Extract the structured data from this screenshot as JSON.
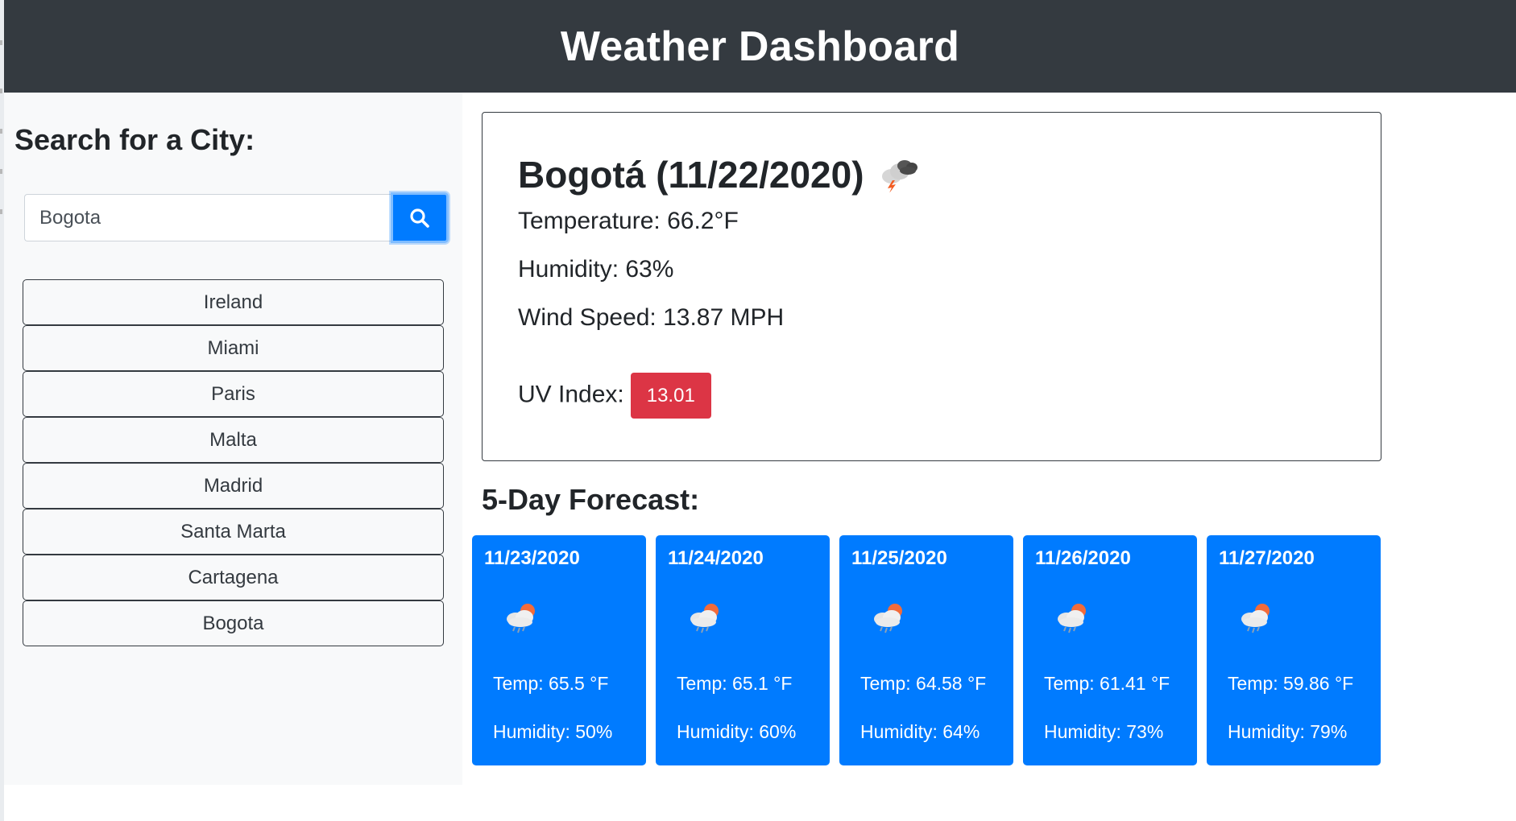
{
  "app": {
    "title": "Weather Dashboard"
  },
  "search": {
    "heading": "Search for a City:",
    "value": "Bogota",
    "button_icon": "search-icon"
  },
  "history": [
    "Ireland",
    "Miami",
    "Paris",
    "Malta",
    "Madrid",
    "Santa Marta",
    "Cartagena",
    "Bogota"
  ],
  "current": {
    "title": "Bogotá (11/22/2020)",
    "icon": "thunderstorm-icon",
    "temperature": "Temperature: 66.2°F",
    "humidity": "Humidity: 63%",
    "wind": "Wind Speed: 13.87 MPH",
    "uv_label": "UV Index:",
    "uv_value": "13.01",
    "uv_color": "#dc3545"
  },
  "forecast": {
    "heading": "5-Day Forecast:",
    "days": [
      {
        "date": "11/23/2020",
        "icon": "rain-cloud-sun-icon",
        "temp": "Temp: 65.5 °F",
        "humidity": "Humidity: 50%"
      },
      {
        "date": "11/24/2020",
        "icon": "rain-cloud-sun-icon",
        "temp": "Temp: 65.1 °F",
        "humidity": "Humidity: 60%"
      },
      {
        "date": "11/25/2020",
        "icon": "rain-cloud-sun-icon",
        "temp": "Temp: 64.58 °F",
        "humidity": "Humidity: 64%"
      },
      {
        "date": "11/26/2020",
        "icon": "rain-cloud-sun-icon",
        "temp": "Temp: 61.41 °F",
        "humidity": "Humidity: 73%"
      },
      {
        "date": "11/27/2020",
        "icon": "rain-cloud-sun-icon",
        "temp": "Temp: 59.86 °F",
        "humidity": "Humidity: 79%"
      }
    ]
  },
  "colors": {
    "header": "#343a40",
    "primary": "#007bff",
    "danger": "#dc3545",
    "sidebar": "#f8f9fa"
  }
}
